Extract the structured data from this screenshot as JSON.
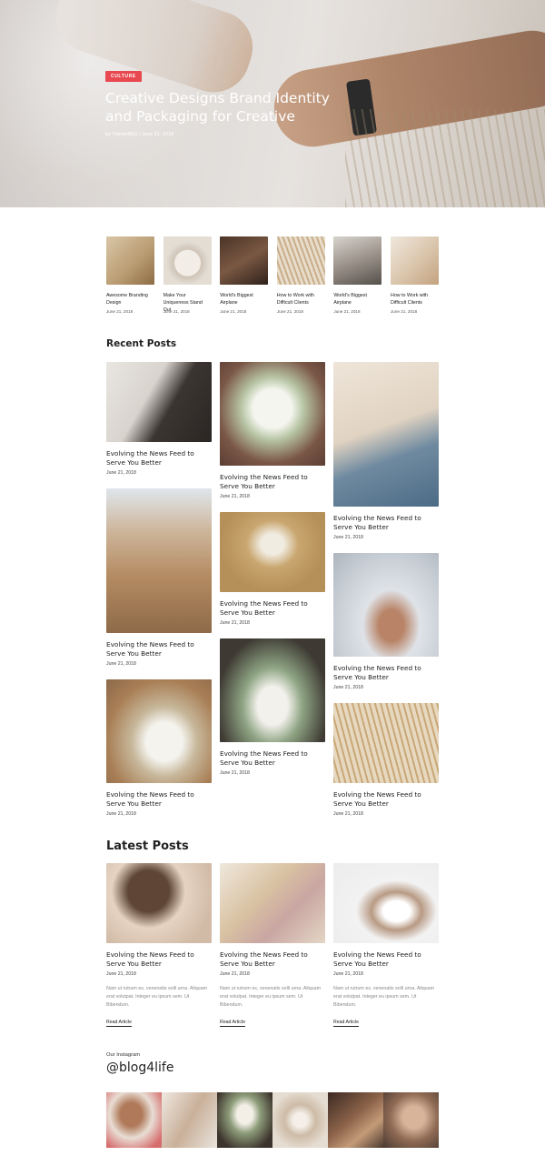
{
  "hero": {
    "tag": "CULTURE",
    "title": "Creative Designs Brand Identity and Packaging for Creative",
    "meta": "by ThemeREX  /  June 21, 2018"
  },
  "thumbs": [
    {
      "title": "Awesome Branding Design",
      "date": "June 21, 2018"
    },
    {
      "title": "Make Your Uniqueness Stand Out",
      "date": "June 21, 2018"
    },
    {
      "title": "World's Biggest Airplane",
      "date": "June 21, 2018"
    },
    {
      "title": "How to Work with Difficult Clients",
      "date": "June 21, 2018"
    },
    {
      "title": "World's Biggest Airplane",
      "date": "June 21, 2018"
    },
    {
      "title": "How to Work with Difficult Clients",
      "date": "June 21, 2018"
    }
  ],
  "recent": {
    "heading": "Recent Posts",
    "posts": [
      {
        "title": "Evolving the News Feed to Serve You Better",
        "date": "June 21, 2018"
      },
      {
        "title": "Evolving the News Feed to Serve You Better",
        "date": "June 21, 2018"
      },
      {
        "title": "Evolving the News Feed to Serve You Better",
        "date": "June 21, 2018"
      },
      {
        "title": "Evolving the News Feed to Serve You Better",
        "date": "June 21, 2018"
      },
      {
        "title": "Evolving the News Feed to Serve You Better",
        "date": "June 21, 2018"
      },
      {
        "title": "Evolving the News Feed to Serve You Better",
        "date": "June 21, 2018"
      },
      {
        "title": "Evolving the News Feed to Serve You Better",
        "date": "June 21, 2018"
      },
      {
        "title": "Evolving the News Feed to Serve You Better",
        "date": "June 21, 2018"
      },
      {
        "title": "Evolving the News Feed to Serve You Better",
        "date": "June 21, 2018"
      }
    ]
  },
  "latest": {
    "heading": "Latest Posts",
    "posts": [
      {
        "title": "Evolving the News Feed to Serve You Better",
        "date": "June 21, 2018",
        "excerpt": "Nam ut rutrum ex, venenatis solli urna. Aliquam erat volutpat. Integer eu ipsum sem. Ut Bibendum.",
        "link": "Read Article"
      },
      {
        "title": "Evolving the News Feed to Serve You Better",
        "date": "June 21, 2018",
        "excerpt": "Nam ut rutrum ex, venenatis solli urna. Aliquam erat volutpat. Integer eu ipsum sem. Ut Bibendum.",
        "link": "Read Article"
      },
      {
        "title": "Evolving the News Feed to Serve You Better",
        "date": "June 21, 2018",
        "excerpt": "Nam ut rutrum ex, venenatis solli urna. Aliquam erat volutpat. Integer eu ipsum sem. Ut Bibendum.",
        "link": "Read Article"
      }
    ]
  },
  "instagram": {
    "label": "Our Instagram",
    "handle": "@blog4life"
  }
}
